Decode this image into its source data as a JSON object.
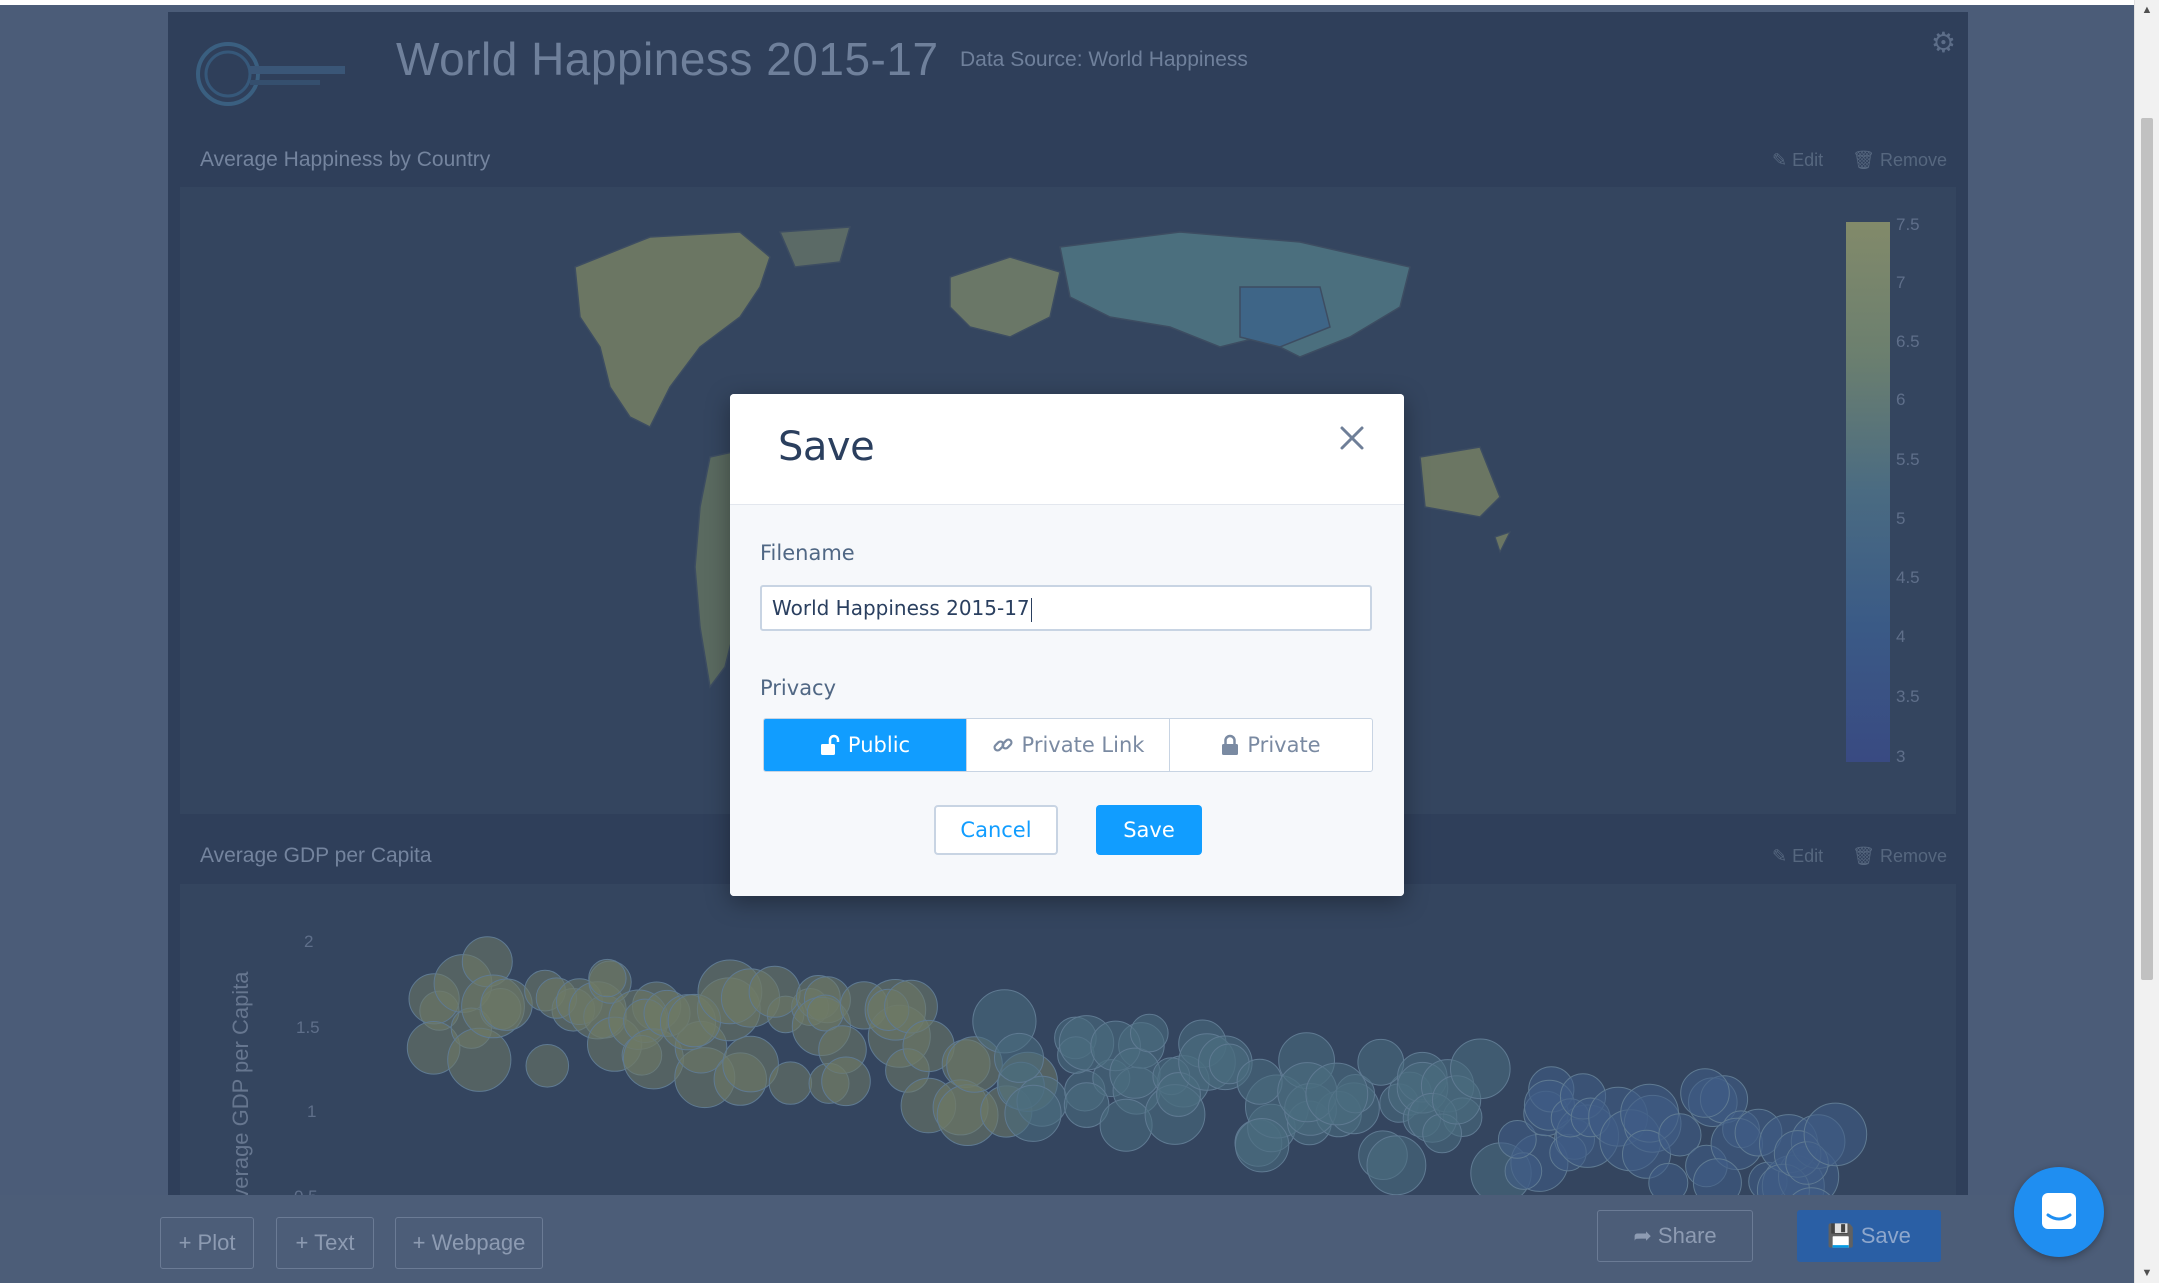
{
  "dashboard": {
    "title": "World Happiness 2015-17",
    "data_source": "Data Source: World Happiness",
    "panels": [
      {
        "title": "Average Happiness by Country",
        "edit_label": "Edit",
        "remove_label": "Remove",
        "colorbar_ticks": [
          "7.5",
          "7",
          "6.5",
          "6",
          "5.5",
          "5",
          "4.5",
          "4",
          "3.5",
          "3"
        ]
      },
      {
        "title": "Average GDP per Capita",
        "edit_label": "Edit",
        "remove_label": "Remove",
        "y_ticks": [
          "2",
          "1.5",
          "1",
          "0.5"
        ],
        "y_axis_label": "Average GDP per Capita"
      }
    ]
  },
  "toolbar": {
    "add_plot": "+ Plot",
    "add_text": "+ Text",
    "add_webpage": "+ Webpage",
    "share": "Share",
    "save": "Save"
  },
  "modal": {
    "title": "Save",
    "filename_label": "Filename",
    "filename_value": "World Happiness 2015-17",
    "privacy_label": "Privacy",
    "privacy_options": [
      "Public",
      "Private Link",
      "Private"
    ],
    "privacy_selected": "Public",
    "cancel_label": "Cancel",
    "save_label": "Save"
  },
  "colors": {
    "accent": "#119dff",
    "modal_title": "#2b3f5e",
    "overlay_bg": "#4b5c78"
  }
}
